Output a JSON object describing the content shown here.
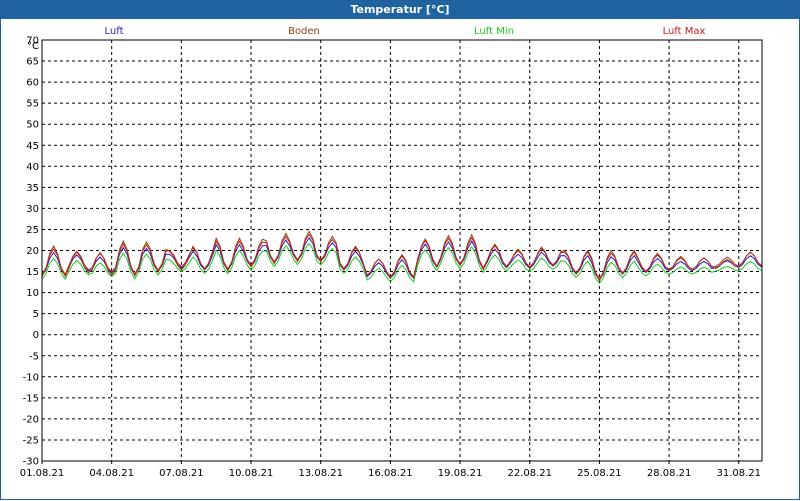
{
  "window": {
    "title": "Temperatur [°C]"
  },
  "colors": {
    "titlebar": "#1f63a0",
    "grid": "#000000",
    "luft": "#1f1fbf",
    "boden": "#8b4513",
    "luft_min": "#1ec81e",
    "luft_max": "#c81e1e"
  },
  "chart_data": {
    "type": "line",
    "title": "Temperatur [°C]",
    "ylabel": "°C",
    "ylim": [
      -30,
      70
    ],
    "ytick_step": 5,
    "x_range": [
      "01.08.21",
      "01.09.21"
    ],
    "xticks": [
      "01.08.21",
      "04.08.21",
      "07.08.21",
      "10.08.21",
      "13.08.21",
      "16.08.21",
      "19.08.21",
      "22.08.21",
      "25.08.21",
      "28.08.21",
      "31.08.21"
    ],
    "grid": true,
    "legend_position": "top",
    "series": [
      {
        "name": "Luft",
        "color": "#1f1fbf",
        "base": [
          16,
          16.5,
          16,
          16.5,
          17,
          17,
          17,
          17.5,
          18,
          19,
          19.5,
          19,
          17,
          15,
          15,
          18,
          18.5,
          18,
          17.5,
          17,
          17.5,
          16,
          15,
          16,
          16,
          16,
          16,
          16.5,
          17
        ],
        "amp": [
          5,
          3.5,
          3.5,
          6,
          5,
          3,
          4,
          5.5,
          4.5,
          5,
          5,
          4,
          4,
          3,
          4,
          5,
          5,
          6,
          4,
          3,
          3,
          4,
          5,
          4,
          3,
          2,
          2,
          1.5,
          2.5
        ]
      },
      {
        "name": "Boden",
        "color": "#8b4513",
        "base": [
          16.5,
          16.5,
          16,
          17,
          17.5,
          17,
          17.5,
          18,
          18.5,
          19.5,
          20,
          19.5,
          17.5,
          15.5,
          15.5,
          18.5,
          19,
          18.5,
          18,
          17.5,
          18,
          16.5,
          15.5,
          16.5,
          16.5,
          16.5,
          16.5,
          16.5,
          17.5
        ],
        "amp": [
          6.5,
          4.5,
          5,
          7.5,
          6.5,
          4,
          5,
          7,
          6,
          6.5,
          6.5,
          5.5,
          5,
          3.5,
          5,
          6,
          6.5,
          7.5,
          5,
          4,
          4,
          5,
          6.5,
          5,
          4,
          3,
          2.5,
          2,
          3
        ]
      },
      {
        "name": "Luft Min",
        "color": "#1ec81e",
        "base": [
          15,
          15.5,
          15,
          15.5,
          16,
          16,
          16,
          16.5,
          17,
          18,
          18.5,
          18,
          16,
          14,
          14,
          17,
          17.5,
          17,
          16.5,
          16,
          16.5,
          15,
          14,
          15,
          15,
          15,
          15,
          15.5,
          16
        ],
        "amp": [
          4.5,
          3,
          3,
          5.5,
          4.5,
          2.5,
          3.5,
          5,
          4,
          4.5,
          4.5,
          3.5,
          3.5,
          2.5,
          3.5,
          4.5,
          4.5,
          5.5,
          3.5,
          2.5,
          2.5,
          3.5,
          4.5,
          3.5,
          2.5,
          1.5,
          1.5,
          1,
          2
        ]
      },
      {
        "name": "Luft Max",
        "color": "#c81e1e",
        "base": [
          16.5,
          17,
          16.5,
          17,
          17.5,
          17.5,
          17.5,
          18,
          18.5,
          19.5,
          20,
          19.5,
          17.5,
          15.5,
          15.5,
          18.5,
          19,
          18.5,
          18,
          17.5,
          18,
          16.5,
          15.5,
          16.5,
          16.5,
          16.5,
          16.5,
          17,
          17.5
        ],
        "amp": [
          5.5,
          4,
          4,
          6.5,
          5.5,
          3.5,
          4.5,
          6,
          5,
          5.5,
          5.5,
          4.5,
          4.5,
          3.5,
          4.5,
          5.5,
          5.5,
          6.5,
          4.5,
          3.5,
          3.5,
          4.5,
          5.5,
          4.5,
          3.5,
          2.5,
          2.5,
          2,
          3
        ]
      }
    ]
  }
}
